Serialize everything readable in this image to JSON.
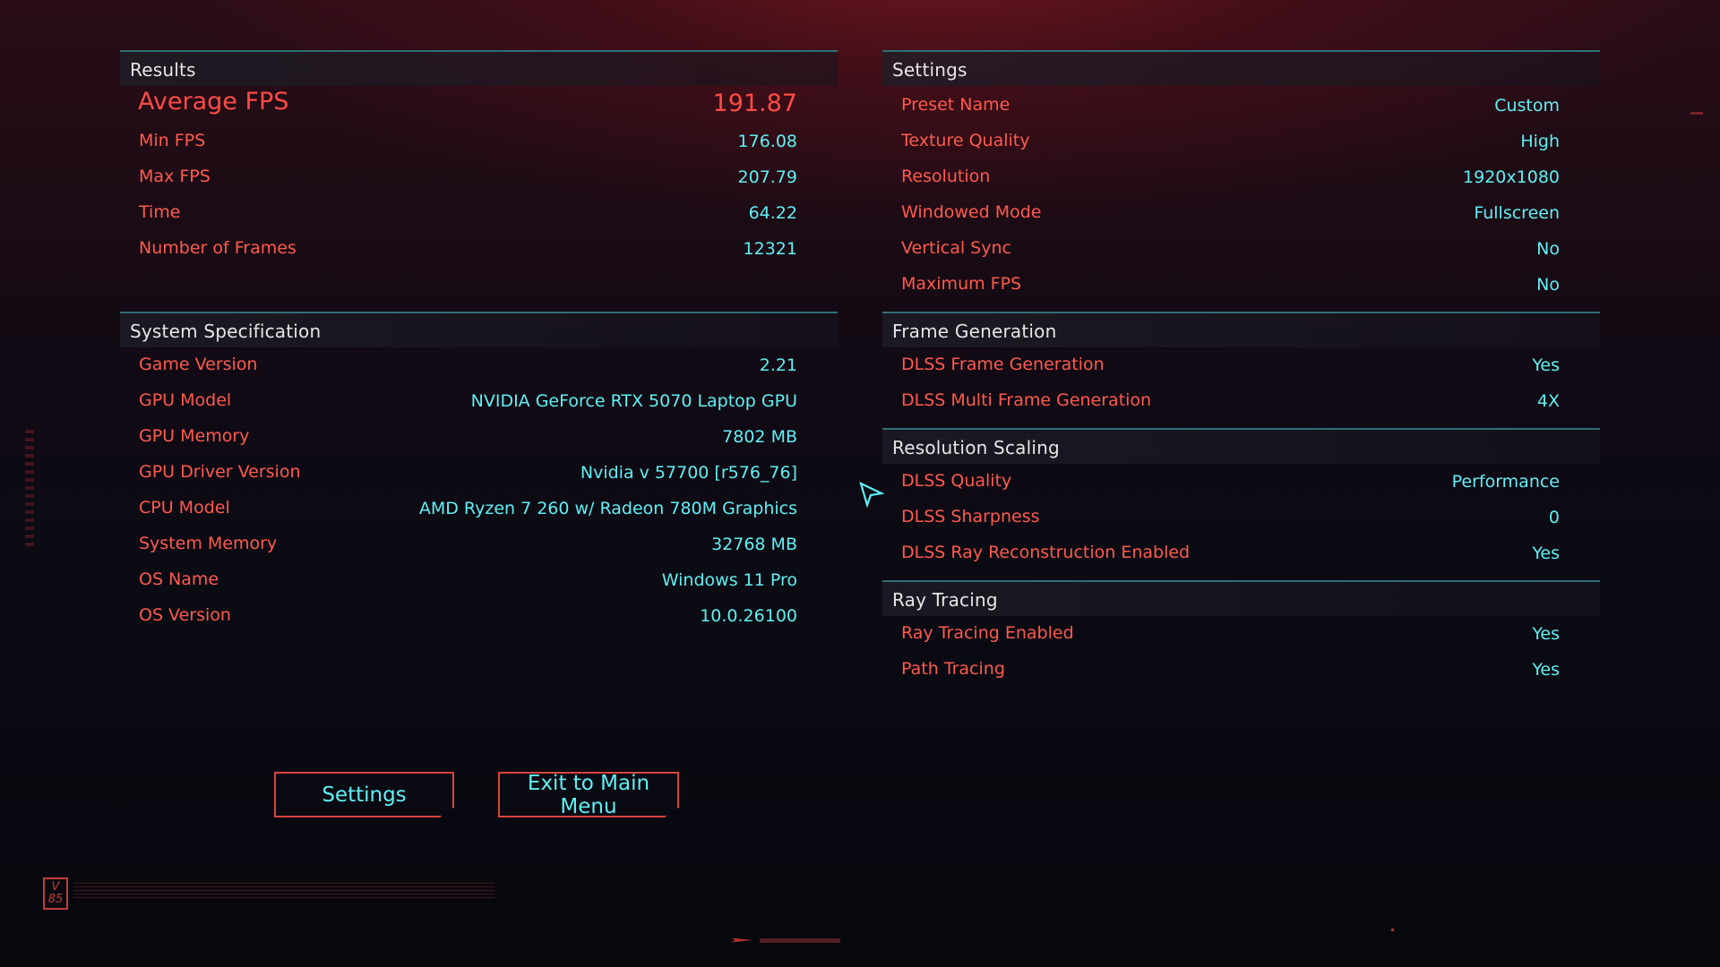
{
  "results": {
    "title": "Results",
    "average_fps": {
      "label": "Average FPS",
      "value": "191.87"
    },
    "rows": [
      {
        "label": "Min FPS",
        "value": "176.08"
      },
      {
        "label": "Max FPS",
        "value": "207.79"
      },
      {
        "label": "Time",
        "value": "64.22"
      },
      {
        "label": "Number of Frames",
        "value": "12321"
      }
    ]
  },
  "system_spec": {
    "title": "System Specification",
    "rows": [
      {
        "label": "Game Version",
        "value": "2.21"
      },
      {
        "label": "GPU Model",
        "value": "NVIDIA GeForce RTX 5070 Laptop GPU"
      },
      {
        "label": "GPU Memory",
        "value": "7802 MB"
      },
      {
        "label": "GPU Driver Version",
        "value": "Nvidia v 57700 [r576_76]"
      },
      {
        "label": "CPU Model",
        "value": "AMD Ryzen 7 260 w/ Radeon 780M Graphics"
      },
      {
        "label": "System Memory",
        "value": "32768 MB"
      },
      {
        "label": "OS Name",
        "value": "Windows 11 Pro"
      },
      {
        "label": "OS Version",
        "value": "10.0.26100"
      }
    ]
  },
  "settings": {
    "title": "Settings",
    "rows": [
      {
        "label": "Preset Name",
        "value": "Custom"
      },
      {
        "label": "Texture Quality",
        "value": "High"
      },
      {
        "label": "Resolution",
        "value": "1920x1080"
      },
      {
        "label": "Windowed Mode",
        "value": "Fullscreen"
      },
      {
        "label": "Vertical Sync",
        "value": "No"
      },
      {
        "label": "Maximum FPS",
        "value": "No"
      }
    ]
  },
  "frame_generation": {
    "title": "Frame Generation",
    "rows": [
      {
        "label": "DLSS Frame Generation",
        "value": "Yes"
      },
      {
        "label": "DLSS Multi Frame Generation",
        "value": "4X"
      }
    ]
  },
  "resolution_scaling": {
    "title": "Resolution Scaling",
    "rows": [
      {
        "label": "DLSS Quality",
        "value": "Performance"
      },
      {
        "label": "DLSS Sharpness",
        "value": "0"
      },
      {
        "label": "DLSS Ray Reconstruction Enabled",
        "value": "Yes"
      }
    ]
  },
  "ray_tracing": {
    "title": "Ray Tracing",
    "rows": [
      {
        "label": "Ray Tracing Enabled",
        "value": "Yes"
      },
      {
        "label": "Path Tracing",
        "value": "Yes"
      }
    ]
  },
  "buttons": {
    "settings_label": "Settings",
    "exit_label": "Exit to Main Menu"
  },
  "badge": {
    "text": "V 85"
  },
  "icons": {
    "cursor": "pointer-cursor-icon",
    "arrow": "arrow-right-icon"
  },
  "colors": {
    "label_red": "#ff5a4e",
    "value_cyan": "#5ff0f4",
    "header_line": "#2f6f78",
    "button_border": "#d9443d"
  }
}
